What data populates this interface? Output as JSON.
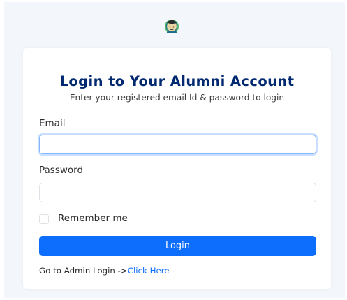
{
  "logo": {
    "icon": "graduate-logo-icon",
    "colors": {
      "face": "#e9d6a2",
      "outline": "#1f6f8b",
      "cap": "#2c2c2c",
      "ring": "#34a853"
    }
  },
  "login_card": {
    "title": "Login to Your Alumni Account",
    "subtitle": "Enter your registered email Id & password to login",
    "email": {
      "label": "Email",
      "value": ""
    },
    "password": {
      "label": "Password",
      "value": ""
    },
    "remember_me": {
      "label": "Remember me",
      "checked": false
    },
    "login_button": "Login",
    "admin_prompt": "Go to Admin Login ->",
    "admin_link": "Click Here"
  },
  "theme": {
    "title_color": "#012970",
    "primary": "#0d6efd",
    "page_background": "#f3f6fb"
  }
}
